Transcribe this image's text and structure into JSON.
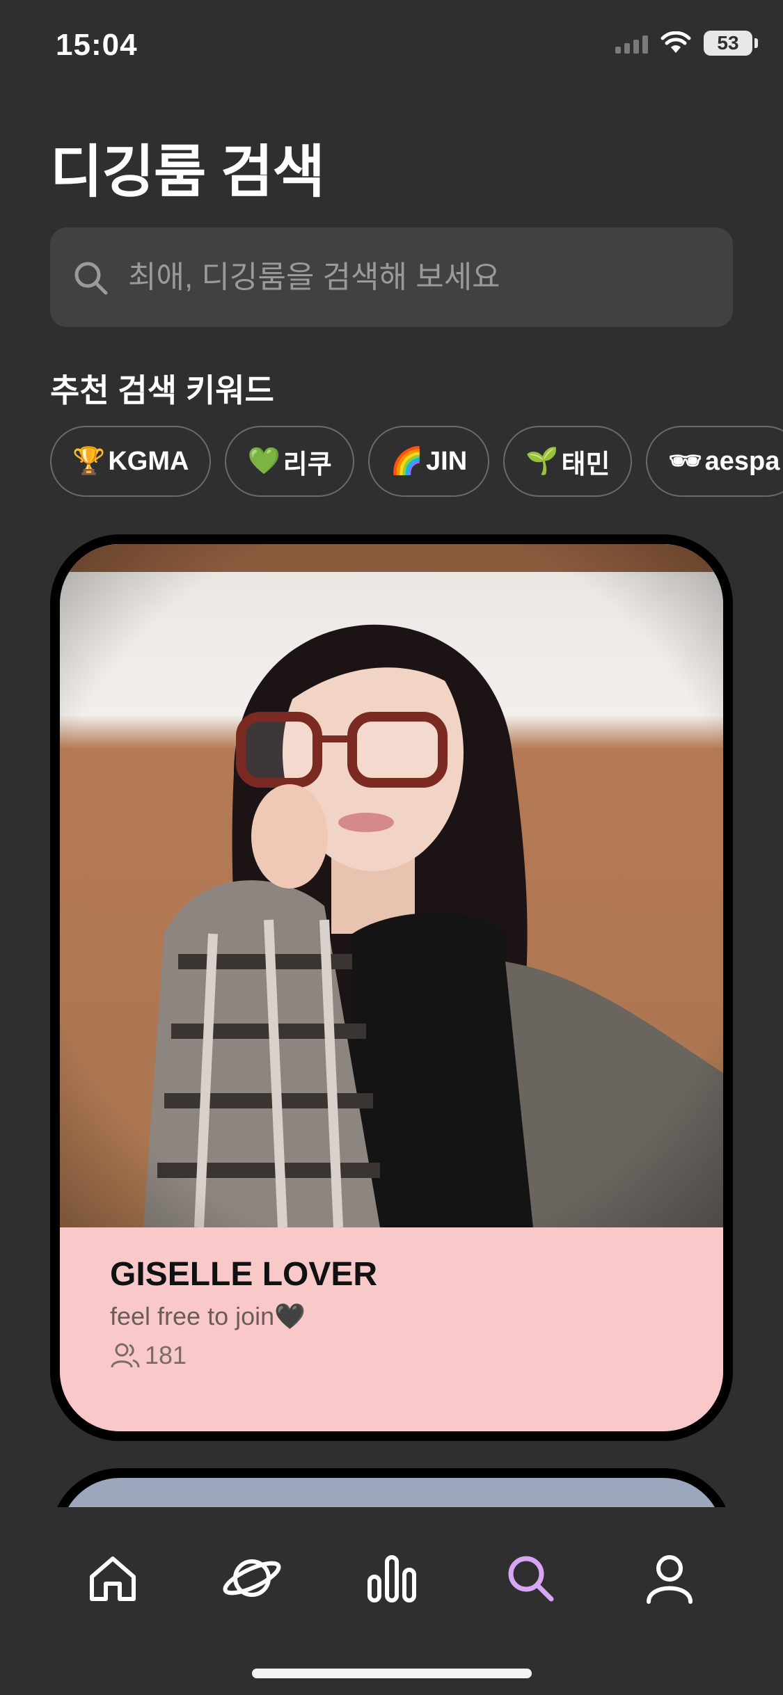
{
  "status_bar": {
    "time": "15:04",
    "battery": "53"
  },
  "page": {
    "title": "디깅룸 검색"
  },
  "search": {
    "placeholder": "최애, 디깅룸을 검색해 보세요"
  },
  "keywords": {
    "title": "추천 검색 키워드",
    "items": [
      {
        "emoji": "🏆",
        "label": "KGMA"
      },
      {
        "emoji": "💚",
        "label": "리쿠"
      },
      {
        "emoji": "🌈",
        "label": "JIN"
      },
      {
        "emoji": "🌱",
        "label": "태민"
      },
      {
        "emoji": "🕶",
        "label": "aespa"
      }
    ]
  },
  "rooms": [
    {
      "name": "GISELLE LOVER",
      "description": "feel free to join🖤",
      "members": "181"
    }
  ],
  "tabs": [
    {
      "name": "home",
      "icon": "home-icon",
      "active": false
    },
    {
      "name": "explore",
      "icon": "planet-icon",
      "active": false
    },
    {
      "name": "chart",
      "icon": "chart-icon",
      "active": false
    },
    {
      "name": "search",
      "icon": "search-icon",
      "active": true
    },
    {
      "name": "profile",
      "icon": "user-icon",
      "active": false
    }
  ],
  "colors": {
    "background": "#2f2f2f",
    "card_info": "#f9c9c9",
    "accent": "#d8a6f5"
  }
}
